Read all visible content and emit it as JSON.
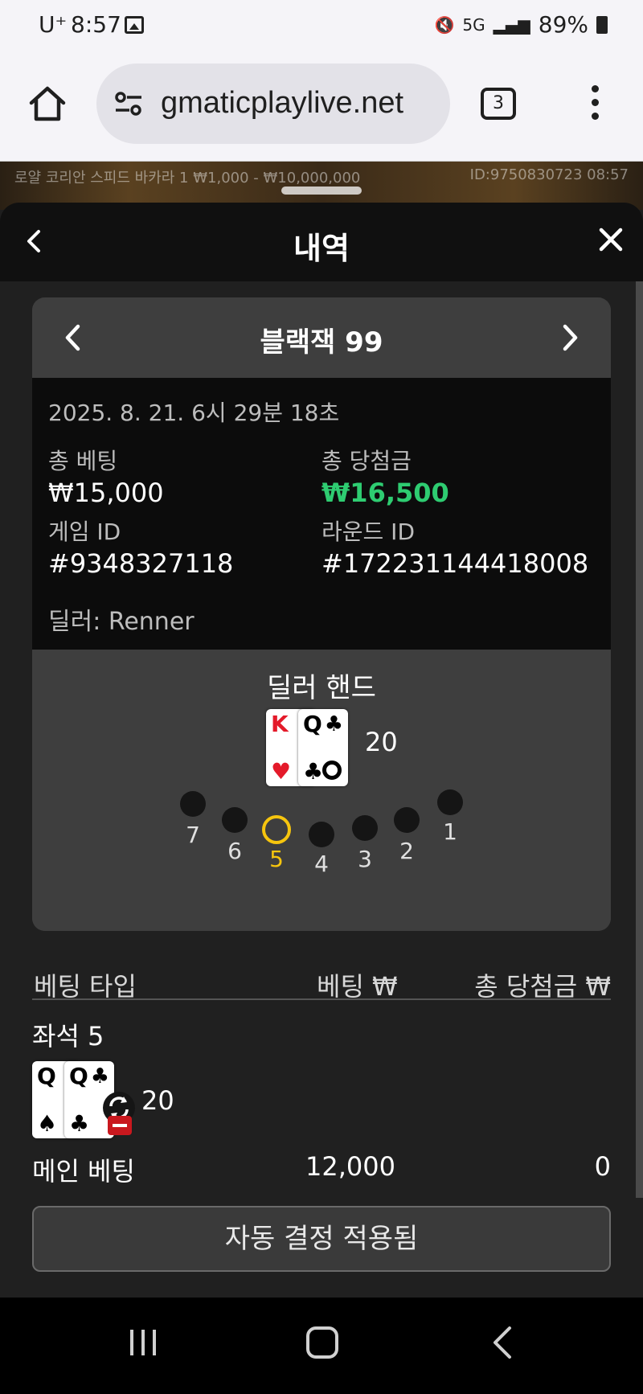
{
  "status": {
    "carrier": "U⁺",
    "time": "8:57",
    "network": "5G",
    "battery": "89%"
  },
  "browser": {
    "url": "gmaticplaylive.net",
    "tab_count": "3"
  },
  "game_strip": {
    "left": "로얄 코리안 스피드 바카라 1  ₩1,000 - ₩10,000,000",
    "right": "ID:9750830723  08:57"
  },
  "sheet": {
    "title": "내역"
  },
  "round": {
    "game_name": "블랙잭 99",
    "datetime": "2025. 8. 21. 6시 29분 18초",
    "total_bet_label": "총 베팅",
    "total_bet": "₩15,000",
    "total_win_label": "총 당첨금",
    "total_win": "₩16,500",
    "game_id_label": "게임 ID",
    "game_id": "#9348327118",
    "round_id_label": "라운드 ID",
    "round_id": "#172231144418008",
    "dealer": "딜러: Renner"
  },
  "dealer_hand": {
    "title": "딜러 핸드",
    "cards": [
      {
        "rank": "K",
        "suit": "♥",
        "color": "red"
      },
      {
        "rank": "Q",
        "suit": "♣",
        "color": "black"
      }
    ],
    "total": "20"
  },
  "seats": {
    "numbers": [
      "7",
      "6",
      "5",
      "4",
      "3",
      "2",
      "1"
    ],
    "active": "5"
  },
  "table": {
    "col_type": "베팅 타입",
    "col_bet": "베팅 ₩",
    "col_win": "총 당첨금 ₩",
    "seat_label": "좌석 5",
    "player_cards": [
      {
        "rank": "Q",
        "suit": "♠",
        "color": "black"
      },
      {
        "rank": "Q",
        "suit": "♣",
        "color": "black"
      }
    ],
    "player_total": "20",
    "rows": [
      {
        "type": "메인 베팅",
        "bet": "12,000",
        "win": "0"
      }
    ]
  },
  "footer": {
    "auto_decision": "자동 결정 적용됨"
  },
  "colors": {
    "win_green": "#2ecc71",
    "active_seat": "#f6c50e",
    "card_red": "#e41a2a"
  }
}
